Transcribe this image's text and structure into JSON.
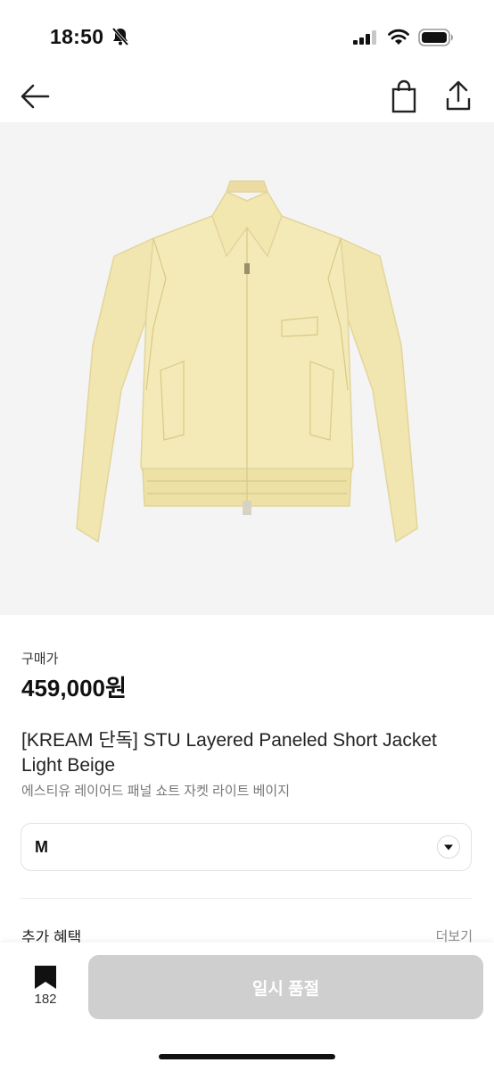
{
  "status_bar": {
    "time": "18:50",
    "icons": [
      "bell-slash-icon",
      "cellular-signal-icon",
      "wifi-icon",
      "battery-icon"
    ]
  },
  "nav": {
    "icons": [
      "back-arrow-icon",
      "shopping-bag-icon",
      "share-icon"
    ]
  },
  "product": {
    "image": "light-beige-short-jacket",
    "price_label": "구매가",
    "price": "459,000원",
    "title": "[KREAM 단독] STU Layered Paneled Short Jacket Light Beige",
    "subtitle": "에스티유 레이어드 패널 쇼트 자켓 라이트 베이지"
  },
  "size_select": {
    "value": "M",
    "icon": "chevron-down-icon"
  },
  "benefits": {
    "title": "추가 혜택",
    "more": "더보기"
  },
  "bottom_bar": {
    "bookmark_count": "182",
    "soldout_label": "일시 품절"
  },
  "colors": {
    "image_background": "#f4f4f4",
    "jacket": "#f3e9b6",
    "button_disabled": "#cfcfcf"
  }
}
